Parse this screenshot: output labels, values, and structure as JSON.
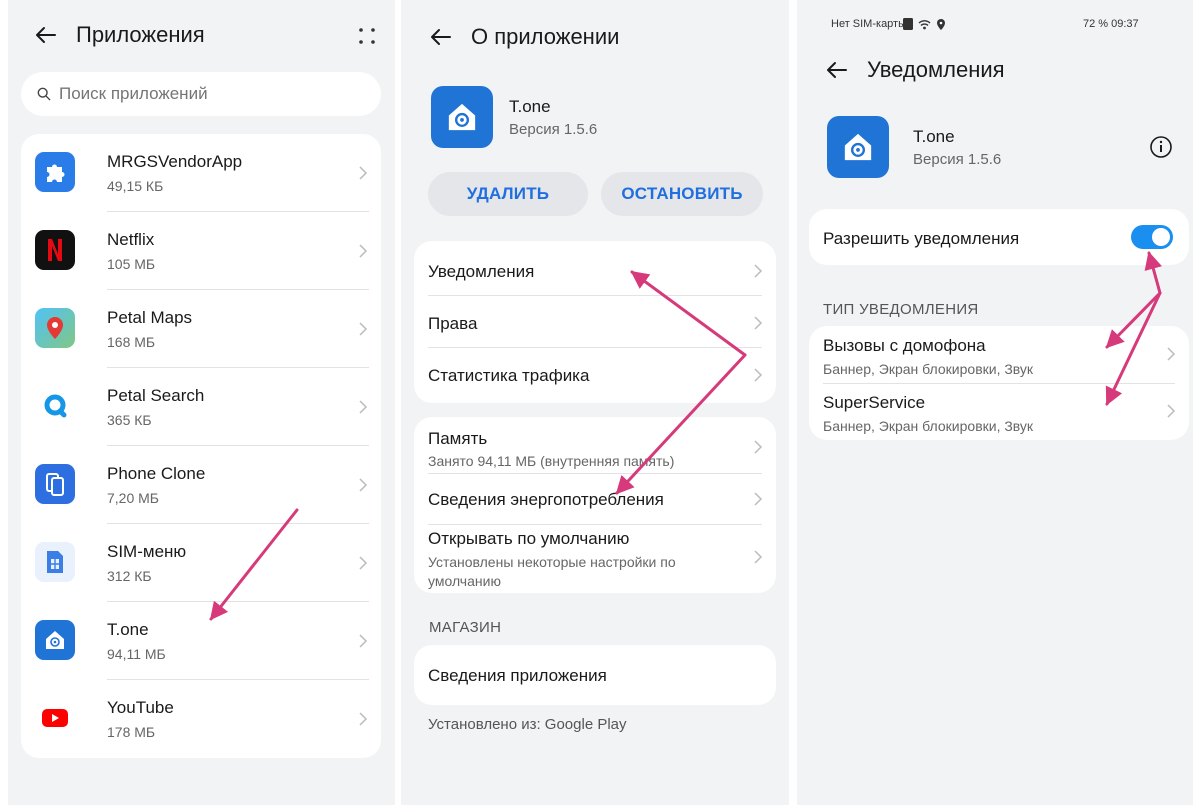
{
  "apps_screen": {
    "title": "Приложения",
    "search_placeholder": "Поиск приложений",
    "apps": [
      {
        "name": "MRGSVendorApp",
        "size": "49,15 КБ",
        "icon": "puzzle-icon"
      },
      {
        "name": "Netflix",
        "size": "105 МБ",
        "icon": "netflix-icon"
      },
      {
        "name": "Petal Maps",
        "size": "168 МБ",
        "icon": "map-pin-icon"
      },
      {
        "name": "Petal Search",
        "size": "365 КБ",
        "icon": "search-ring-icon"
      },
      {
        "name": "Phone Clone",
        "size": "7,20 МБ",
        "icon": "phone-clone-icon"
      },
      {
        "name": "SIM-меню",
        "size": "312 КБ",
        "icon": "sim-icon"
      },
      {
        "name": "T.one",
        "size": "94,11 МБ",
        "icon": "tone-house-icon"
      },
      {
        "name": "YouTube",
        "size": "178 МБ",
        "icon": "youtube-icon"
      }
    ]
  },
  "app_info_screen": {
    "title": "О приложении",
    "app_name": "T.one",
    "version": "Версия 1.5.6",
    "uninstall_label": "УДАЛИТЬ",
    "stop_label": "ОСТАНОВИТЬ",
    "group1": [
      "Уведомления",
      "Права",
      "Статистика трафика"
    ],
    "memory_label": "Память",
    "memory_sub": "Занято 94,11 МБ (внутренняя память)",
    "energy_label": "Сведения энергопотребления",
    "default_label": "Открывать по умолчанию",
    "default_sub": "Установлены некоторые настройки по умолчанию",
    "store_section": "МАГАЗИН",
    "app_details_label": "Сведения приложения",
    "installed_from": "Установлено из: Google Play"
  },
  "notifications_screen": {
    "status_left": "Нет SIM-карты",
    "status_right": "72 % 09:37",
    "title": "Уведомления",
    "app_name": "T.one",
    "version": "Версия 1.5.6",
    "allow_label": "Разрешить уведомления",
    "allow_enabled": true,
    "section_title": "ТИП УВЕДОМЛЕНИЯ",
    "channels": [
      {
        "name": "Вызовы с домофона",
        "sub": "Баннер, Экран блокировки, Звук"
      },
      {
        "name": "SuperService",
        "sub": "Баннер, Экран блокировки, Звук"
      }
    ]
  },
  "colors": {
    "accent": "#1f6fe0",
    "annotation_arrow": "#d63a7b",
    "toggle_on": "#1a8ff0",
    "app_icon_blue": "#1f74d6"
  }
}
